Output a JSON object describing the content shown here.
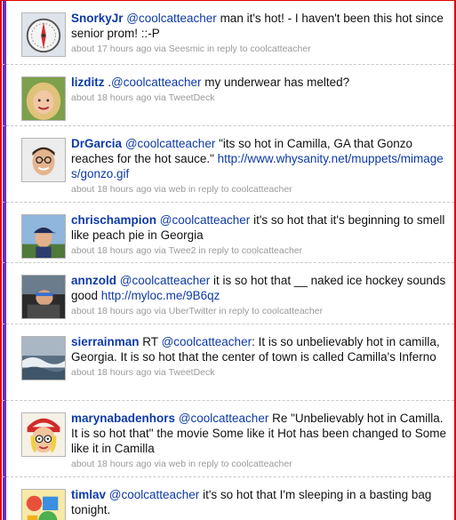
{
  "colors": {
    "link": "#0d3aa8",
    "meta": "#9a9a9a",
    "frame": "#e00000",
    "accent": "#6a2cc4"
  },
  "tweets": [
    {
      "user": "SnorkyJr",
      "mention": "@coolcatteacher",
      "text": " man it's hot! - I haven't been this hot since senior prom! ::-P",
      "time": "about 17 hours ago",
      "via_prefix": " via ",
      "source": "Seesmic",
      "reply_prefix": " in reply to ",
      "reply_to": "coolcatteacher",
      "avatar": "compass-avatar-icon"
    },
    {
      "user": "lizditz",
      "pre": " .",
      "mention": "@coolcatteacher",
      "text": " my underwear has melted?",
      "time": "about 18 hours ago",
      "via_prefix": " via ",
      "source": "TweetDeck",
      "avatar": "blonde-woman-avatar-icon"
    },
    {
      "user": "DrGarcia",
      "mention": "@coolcatteacher",
      "text": " \"its so hot in Camilla, GA that Gonzo reaches for the hot sauce.\" ",
      "link": "http://www.whysanity.net/muppets/mimages/gonzo.gif",
      "time": "about 18 hours ago",
      "via_prefix": " via ",
      "source": "web",
      "reply_prefix": " in reply to ",
      "reply_to": "coolcatteacher",
      "avatar": "man-glasses-avatar-icon"
    },
    {
      "user": "chrischampion",
      "mention": "@coolcatteacher",
      "text": " it's so hot that it's beginning to smell like peach pie in Georgia",
      "time": "about 18 hours ago",
      "via_prefix": " via ",
      "source": "Twee2",
      "reply_prefix": " in reply to ",
      "reply_to": "coolcatteacher",
      "avatar": "man-cap-avatar-icon"
    },
    {
      "user": "annzold",
      "mention": "@coolcatteacher",
      "text": " it is so hot that __ naked ice hockey sounds good ",
      "link": "http://myloc.me/9B6qz",
      "time": "about 18 hours ago",
      "via_prefix": " via ",
      "source": "UberTwitter",
      "reply_prefix": " in reply to ",
      "reply_to": "coolcatteacher",
      "avatar": "person-car-avatar-icon"
    },
    {
      "user": "sierrainman",
      "pre": " RT ",
      "mention": "@coolcatteacher",
      "text": ": It is so unbelievably hot in camilla, Georgia. It is so hot that the center of town is called Camilla's Inferno",
      "time": "about 18 hours ago",
      "via_prefix": " via ",
      "source": "TweetDeck",
      "avatar": "ocean-wave-avatar-icon"
    },
    {
      "user": "marynabadenhors",
      "mention": "@coolcatteacher",
      "text": " Re \"Unbelievably hot in Camilla. It is so hot that\" the movie Some like it Hot has been changed to Some like it in Camilla",
      "time": "about 18 hours ago",
      "via_prefix": " via ",
      "source": "web",
      "reply_prefix": " in reply to ",
      "reply_to": "coolcatteacher",
      "avatar": "cartoon-woman-avatar-icon"
    },
    {
      "user": "timlav",
      "mention": "@coolcatteacher",
      "text": " it's so hot that I'm sleeping in a basting bag tonight.",
      "avatar": "colorful-toy-avatar-icon"
    }
  ]
}
